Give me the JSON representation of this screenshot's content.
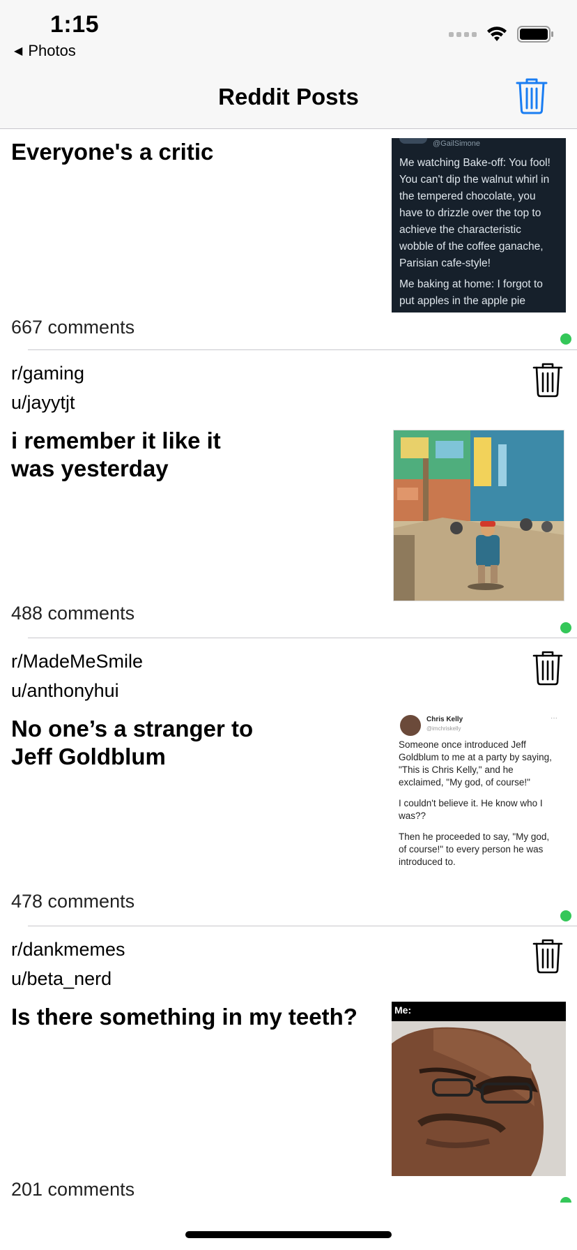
{
  "status_bar": {
    "time": "1:15",
    "back_label": "Photos"
  },
  "nav": {
    "title": "Reddit Posts",
    "trash_icon": "trash-icon",
    "accent": "#1a7df2"
  },
  "posts": [
    {
      "title": "Everyone's a critic",
      "comments": "667 comments",
      "thumb": {
        "author": "@GailSimone",
        "lines": [
          "Me watching Bake-off: You fool!",
          "You can't dip the walnut whirl in",
          "the tempered chocolate, you",
          "have to drizzle over the top to",
          "achieve the characteristic",
          "wobble of the coffee ganache,",
          "Parisian cafe-style!",
          "Me baking at home:  I forgot to",
          "put apples in the apple pie"
        ]
      }
    },
    {
      "subreddit": "r/gaming",
      "user": "u/jayytjt",
      "title": "i remember it like it was yesterday",
      "comments": "488 comments"
    },
    {
      "subreddit": "r/MadeMeSmile",
      "user": "u/anthonyhui",
      "title": "No one’s a stranger to Jeff Goldblum",
      "comments": "478 comments",
      "thumb": {
        "name": "Chris Kelly",
        "handle": "@imchriskelly",
        "p1": "Someone once introduced Jeff Goldblum to me at a party by saying, \"This is Chris Kelly,\" and he exclaimed, \"My god, of course!\"",
        "p2": "I couldn't believe it. He know who I was??",
        "p3": "Then he proceeded to say, \"My god, of course!\" to every person he was introduced to."
      }
    },
    {
      "subreddit": "r/dankmemes",
      "user": "u/beta_nerd",
      "title": "Is there something in my teeth?",
      "comments": "201 comments",
      "thumb": {
        "caption": "Me:"
      }
    }
  ],
  "status_dot_color": "#34c759"
}
